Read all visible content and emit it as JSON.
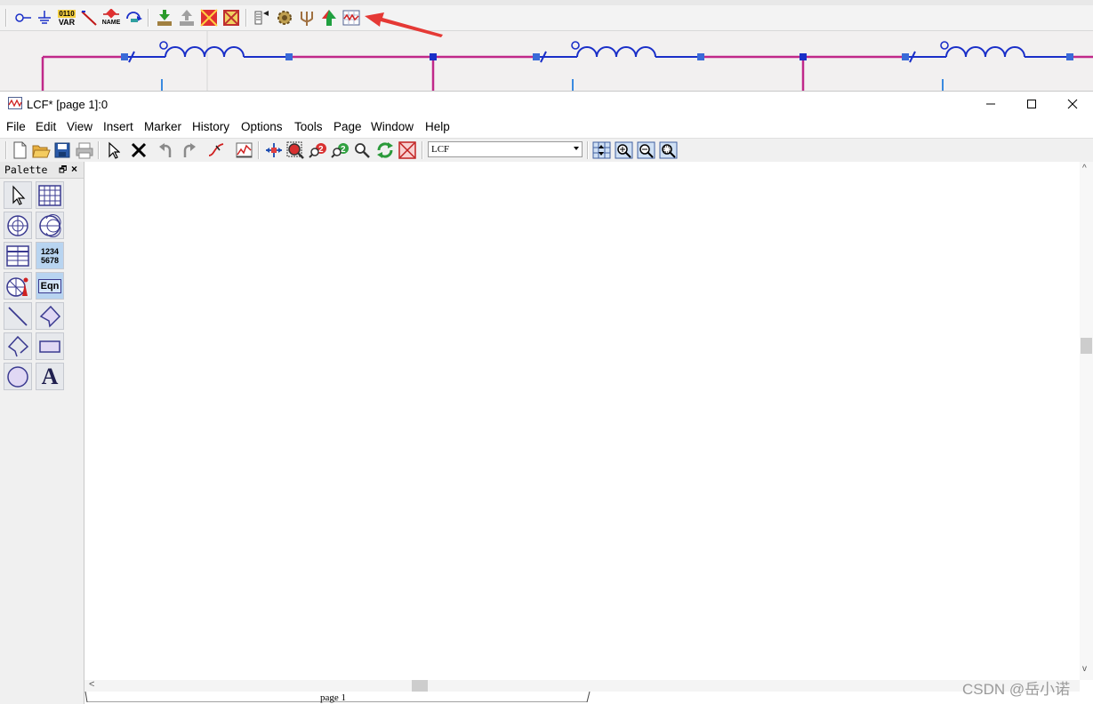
{
  "window": {
    "title": "LCF* [page 1]:0",
    "minimize_icon": "minimize-icon",
    "maximize_icon": "maximize-icon",
    "close_icon": "close-icon"
  },
  "menu": [
    "File",
    "Edit",
    "View",
    "Insert",
    "Marker",
    "History",
    "Options",
    "Tools",
    "Page",
    "Window",
    "Help"
  ],
  "toolbar": {
    "icons": [
      "new-icon",
      "open-icon",
      "save-icon",
      "print-icon",
      "pointer-icon",
      "delete-icon",
      "undo-icon",
      "redo-icon",
      "trace-icon",
      "plot-icon",
      "pan-icon",
      "zoom-icon",
      "zoom-in-icon",
      "zoom-out-icon",
      "zoom-icon",
      "refresh-icon",
      "stop-icon",
      "zoom-fit-icon",
      "zoom-plus-icon",
      "zoom-minus-icon",
      "zoom-area-icon"
    ],
    "dataset_select": "LCF"
  },
  "background_toolbar": {
    "var_label": "VAR",
    "var_bits": "0110",
    "name_label": "NAME"
  },
  "palette": {
    "title": "Palette",
    "numbers_top": "1234",
    "numbers_bottom": "5678",
    "eqn_label": "Eqn",
    "text_label": "A"
  },
  "page_tab": "page 1",
  "watermark": "CSDN @岳小诺",
  "colors": {
    "wire": "#c0288a",
    "component": "#1a2fc8",
    "node": "#2355c8",
    "arrow": "#e53935"
  }
}
